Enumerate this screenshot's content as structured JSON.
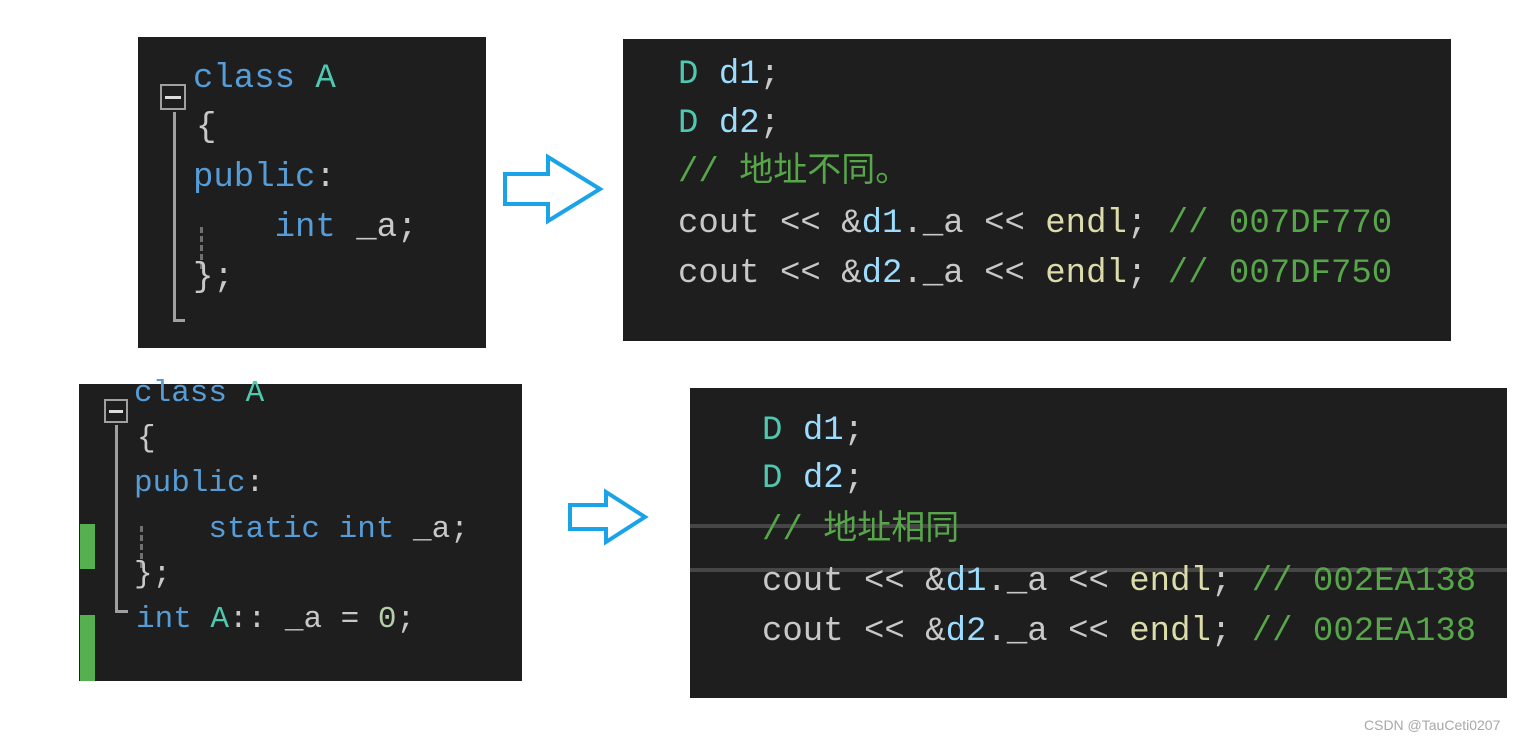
{
  "colors": {
    "keyword": "#569cd6",
    "type": "#4ec9b0",
    "variable": "#9cdcfe",
    "comment": "#57a64a",
    "function": "#dcdcaa",
    "text": "#c8c8c8",
    "arrow": "#1aa3e8",
    "change_marker": "#57b04f"
  },
  "panels": [
    {
      "id": "p1",
      "lines": [
        [
          [
            "kw",
            "class "
          ],
          [
            "ty",
            "A"
          ]
        ],
        [
          [
            "tx",
            "{"
          ]
        ],
        [
          [
            "kw",
            "public"
          ],
          [
            "tx",
            ":"
          ]
        ],
        [
          [
            "tx",
            "    "
          ],
          [
            "kw",
            "int"
          ],
          [
            "tx",
            " _a;"
          ]
        ],
        [
          [
            "tx",
            "};"
          ]
        ]
      ]
    },
    {
      "id": "p2",
      "lines": [
        [
          [
            "ty",
            "D"
          ],
          [
            "tx",
            " "
          ],
          [
            "var",
            "d1"
          ],
          [
            "tx",
            ";"
          ]
        ],
        [
          [
            "ty",
            "D"
          ],
          [
            "tx",
            " "
          ],
          [
            "var",
            "d2"
          ],
          [
            "tx",
            ";"
          ]
        ],
        [
          [
            "cm",
            "// 地址不同。"
          ]
        ],
        [
          [
            "tx",
            "cout << &"
          ],
          [
            "var",
            "d1"
          ],
          [
            "tx",
            "._a << "
          ],
          [
            "fn",
            "endl"
          ],
          [
            "tx",
            "; "
          ],
          [
            "cm",
            "// 007DF770"
          ]
        ],
        [
          [
            "tx",
            "cout << &"
          ],
          [
            "var",
            "d2"
          ],
          [
            "tx",
            "._a << "
          ],
          [
            "fn",
            "endl"
          ],
          [
            "tx",
            "; "
          ],
          [
            "cm",
            "// 007DF750"
          ]
        ]
      ]
    },
    {
      "id": "p3",
      "lines": [
        [
          [
            "kw",
            "class "
          ],
          [
            "ty",
            "A"
          ]
        ],
        [
          [
            "tx",
            "{"
          ]
        ],
        [
          [
            "kw",
            "public"
          ],
          [
            "tx",
            ":"
          ]
        ],
        [
          [
            "tx",
            "    "
          ],
          [
            "kw",
            "static int"
          ],
          [
            "tx",
            " _a;"
          ]
        ],
        [
          [
            "tx",
            "};"
          ]
        ],
        [
          [
            "kw",
            "int "
          ],
          [
            "ty",
            "A"
          ],
          [
            "tx",
            ":: _a = "
          ],
          [
            "num",
            "0"
          ],
          [
            "tx",
            ";"
          ]
        ]
      ]
    },
    {
      "id": "p4",
      "lines": [
        [
          [
            "ty",
            "D"
          ],
          [
            "tx",
            " "
          ],
          [
            "var",
            "d1"
          ],
          [
            "tx",
            ";"
          ]
        ],
        [
          [
            "ty",
            "D"
          ],
          [
            "tx",
            " "
          ],
          [
            "var",
            "d2"
          ],
          [
            "tx",
            ";"
          ]
        ],
        [
          [
            "cm",
            "// 地址相同"
          ]
        ],
        [
          [
            "tx",
            "cout << &"
          ],
          [
            "var",
            "d1"
          ],
          [
            "tx",
            "._a << "
          ],
          [
            "fn",
            "endl"
          ],
          [
            "tx",
            "; "
          ],
          [
            "cm",
            "// 002EA138"
          ]
        ],
        [
          [
            "tx",
            "cout << &"
          ],
          [
            "var",
            "d2"
          ],
          [
            "tx",
            "._a << "
          ],
          [
            "fn",
            "endl"
          ],
          [
            "tx",
            "; "
          ],
          [
            "cm",
            "// 002EA138"
          ]
        ]
      ]
    }
  ],
  "watermark": "CSDN @TauCeti0207"
}
